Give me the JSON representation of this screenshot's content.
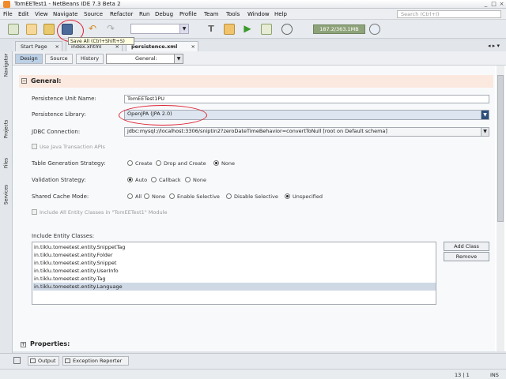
{
  "window": {
    "title": "TomEETest1 - NetBeans IDE 7.3 Beta 2"
  },
  "menu": [
    "File",
    "Edit",
    "View",
    "Navigate",
    "Source",
    "Refactor",
    "Run",
    "Debug",
    "Profile",
    "Team",
    "Tools",
    "Window",
    "Help"
  ],
  "search": {
    "placeholder": "Search (Ctrl+I)"
  },
  "toolbar": {
    "memory": "187.2/363.1MB",
    "tooltip": "Save All (Ctrl+Shift+S)"
  },
  "tabs": [
    {
      "label": "Start Page"
    },
    {
      "label": "index.xhtml"
    },
    {
      "label": "persistence.xml"
    }
  ],
  "sidebar": {
    "navigator": "Navigator",
    "projects": "Projects",
    "files": "Files",
    "services": "Services"
  },
  "views": {
    "design": "Design",
    "source": "Source",
    "history": "History",
    "section": "General:"
  },
  "general": {
    "title": "General:",
    "pu_label": "Persistence Unit Name:",
    "pu_value": "TomEETest1PU",
    "lib_label": "Persistence Library:",
    "lib_value": "OpenJPA (JPA 2.0)",
    "jdbc_label": "JDBC Connection:",
    "jdbc_value": "jdbc:mysql://localhost:3306/sniptin2?zeroDateTimeBehavior=convertToNull [root on Default schema]",
    "jta_label": "Use Java Transaction APIs",
    "tgs_label": "Table Generation Strategy:",
    "tgs_options": [
      "Create",
      "Drop and Create",
      "None"
    ],
    "val_label": "Validation Strategy:",
    "val_options": [
      "Auto",
      "Callback",
      "None"
    ],
    "cache_label": "Shared Cache Mode:",
    "cache_options": [
      "All",
      "None",
      "Enable Selective",
      "Disable Selective",
      "Unspecified"
    ],
    "include_all_label": "Include All Entity Classes in \"TomEETest1\" Module",
    "include_label": "Include Entity Classes:",
    "entities": [
      "in.tiklu.tomeetest.entity.SnippetTag",
      "in.tiklu.tomeetest.entity.Folder",
      "in.tiklu.tomeetest.entity.Snippet",
      "in.tiklu.tomeetest.entity.UserInfo",
      "in.tiklu.tomeetest.entity.Tag",
      "in.tiklu.tomeetest.entity.Language"
    ],
    "add_class": "Add Class",
    "remove": "Remove"
  },
  "properties": {
    "title": "Properties:"
  },
  "bottom": {
    "output": "Output",
    "exception": "Exception Reporter"
  },
  "status": {
    "position": "13 | 1",
    "mode": "INS"
  }
}
